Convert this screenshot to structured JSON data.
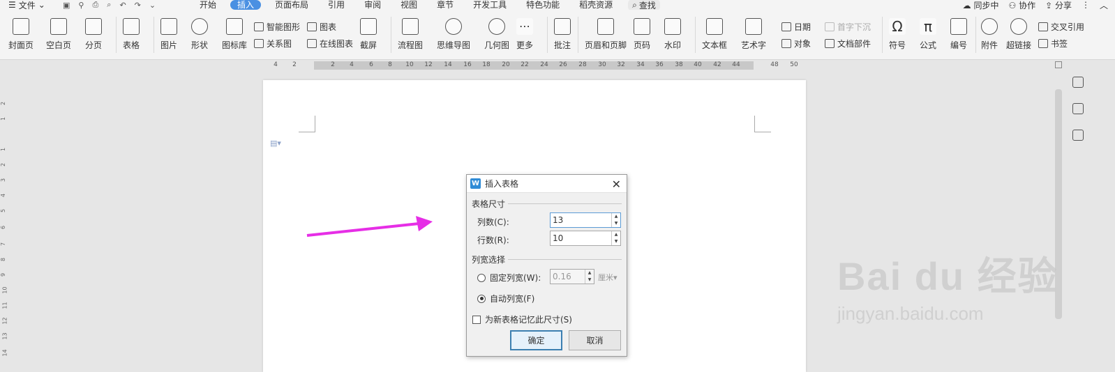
{
  "menubar": {
    "file_label": "文件",
    "tabs": [
      "开始",
      "插入",
      "页面布局",
      "引用",
      "审阅",
      "视图",
      "章节",
      "开发工具",
      "特色功能",
      "稻壳资源"
    ],
    "active_tab": "插入",
    "search_label": "查找",
    "right": [
      "同步中",
      "协作",
      "分享"
    ]
  },
  "ribbon": {
    "cover": "封面页",
    "blank": "空白页",
    "break": "分页",
    "table": "表格",
    "picture": "图片",
    "shape": "形状",
    "icon_lib": "图标库",
    "smart_shape": "智能图形",
    "relation": "关系图",
    "chart": "图表",
    "online_chart": "在线图表",
    "screenshot": "截屏",
    "flowchart": "流程图",
    "mindmap": "思维导图",
    "geometry": "几何图",
    "more": "更多",
    "comment": "批注",
    "header_footer": "页眉和页脚",
    "page_num": "页码",
    "watermark": "水印",
    "textbox": "文本框",
    "wordart": "艺术字",
    "date": "日期",
    "object": "对象",
    "drop_cap": "首字下沉",
    "doc_part": "文档部件",
    "symbol": "符号",
    "formula": "公式",
    "numbering": "编号",
    "attachment": "附件",
    "hyperlink": "超链接",
    "cross_ref": "交叉引用",
    "bookmark": "书签"
  },
  "ruler": {
    "labels": [
      "4",
      "2",
      "2",
      "4",
      "6",
      "8",
      "10",
      "12",
      "14",
      "16",
      "18",
      "20",
      "22",
      "24",
      "26",
      "28",
      "30",
      "32",
      "34",
      "36",
      "38",
      "40",
      "42",
      "44",
      "48",
      "50"
    ],
    "vertical_labels": [
      "2",
      "1",
      "1",
      "2",
      "3",
      "4",
      "5",
      "6",
      "7",
      "8",
      "9",
      "10",
      "11",
      "12",
      "13",
      "14"
    ]
  },
  "dialog": {
    "title": "插入表格",
    "size_section": "表格尺寸",
    "cols_label": "列数(C):",
    "cols_value": "13",
    "rows_label": "行数(R):",
    "rows_value": "10",
    "width_section": "列宽选择",
    "fixed_label": "固定列宽(W):",
    "fixed_value": "0.16",
    "unit": "厘米",
    "auto_label": "自动列宽(F)",
    "auto_selected": true,
    "remember_label": "为新表格记忆此尺寸(S)",
    "remember_checked": false,
    "ok": "确定",
    "cancel": "取消"
  },
  "watermark": {
    "brand": "Bai du 经验",
    "url": "jingyan.baidu.com"
  },
  "colors": {
    "accent": "#4a90e2",
    "arrow": "#e62ee6",
    "logo": "#2f8bd6"
  }
}
